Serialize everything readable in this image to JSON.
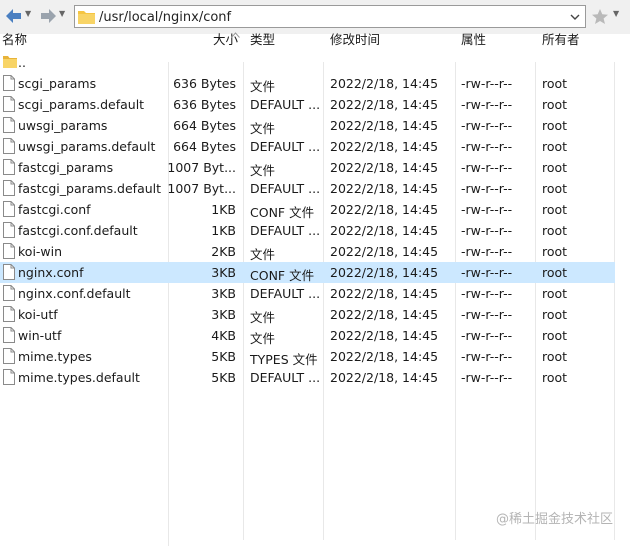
{
  "toolbar": {
    "path": "/usr/local/nginx/conf"
  },
  "columns": {
    "name": "名称",
    "size": "大小",
    "type": "类型",
    "modified": "修改时间",
    "attributes": "属性",
    "owner": "所有者"
  },
  "parent_dir": "..",
  "files": [
    {
      "name": "scgi_params",
      "size": "636 Bytes",
      "type": "文件",
      "modified": "2022/2/18, 14:45",
      "attr": "-rw-r--r--",
      "owner": "root"
    },
    {
      "name": "scgi_params.default",
      "size": "636 Bytes",
      "type": "DEFAULT ...",
      "modified": "2022/2/18, 14:45",
      "attr": "-rw-r--r--",
      "owner": "root"
    },
    {
      "name": "uwsgi_params",
      "size": "664 Bytes",
      "type": "文件",
      "modified": "2022/2/18, 14:45",
      "attr": "-rw-r--r--",
      "owner": "root"
    },
    {
      "name": "uwsgi_params.default",
      "size": "664 Bytes",
      "type": "DEFAULT ...",
      "modified": "2022/2/18, 14:45",
      "attr": "-rw-r--r--",
      "owner": "root"
    },
    {
      "name": "fastcgi_params",
      "size": "1007 Byt...",
      "type": "文件",
      "modified": "2022/2/18, 14:45",
      "attr": "-rw-r--r--",
      "owner": "root"
    },
    {
      "name": "fastcgi_params.default",
      "size": "1007 Byt...",
      "type": "DEFAULT ...",
      "modified": "2022/2/18, 14:45",
      "attr": "-rw-r--r--",
      "owner": "root"
    },
    {
      "name": "fastcgi.conf",
      "size": "1KB",
      "type": "CONF 文件",
      "modified": "2022/2/18, 14:45",
      "attr": "-rw-r--r--",
      "owner": "root"
    },
    {
      "name": "fastcgi.conf.default",
      "size": "1KB",
      "type": "DEFAULT ...",
      "modified": "2022/2/18, 14:45",
      "attr": "-rw-r--r--",
      "owner": "root"
    },
    {
      "name": "koi-win",
      "size": "2KB",
      "type": "文件",
      "modified": "2022/2/18, 14:45",
      "attr": "-rw-r--r--",
      "owner": "root"
    },
    {
      "name": "nginx.conf",
      "size": "3KB",
      "type": "CONF 文件",
      "modified": "2022/2/18, 14:45",
      "attr": "-rw-r--r--",
      "owner": "root",
      "selected": true
    },
    {
      "name": "nginx.conf.default",
      "size": "3KB",
      "type": "DEFAULT ...",
      "modified": "2022/2/18, 14:45",
      "attr": "-rw-r--r--",
      "owner": "root"
    },
    {
      "name": "koi-utf",
      "size": "3KB",
      "type": "文件",
      "modified": "2022/2/18, 14:45",
      "attr": "-rw-r--r--",
      "owner": "root"
    },
    {
      "name": "win-utf",
      "size": "4KB",
      "type": "文件",
      "modified": "2022/2/18, 14:45",
      "attr": "-rw-r--r--",
      "owner": "root"
    },
    {
      "name": "mime.types",
      "size": "5KB",
      "type": "TYPES 文件",
      "modified": "2022/2/18, 14:45",
      "attr": "-rw-r--r--",
      "owner": "root"
    },
    {
      "name": "mime.types.default",
      "size": "5KB",
      "type": "DEFAULT ...",
      "modified": "2022/2/18, 14:45",
      "attr": "-rw-r--r--",
      "owner": "root"
    }
  ],
  "watermark": "@稀土掘金技术社区",
  "colors": {
    "selection": "#cce8ff",
    "nav_arrow": "#4a7fc1",
    "folder": "#f5c542"
  },
  "icons": {
    "back": "back-arrow-icon",
    "forward": "forward-arrow-icon",
    "folder": "folder-icon",
    "file": "file-icon",
    "bookmark": "star-icon"
  }
}
